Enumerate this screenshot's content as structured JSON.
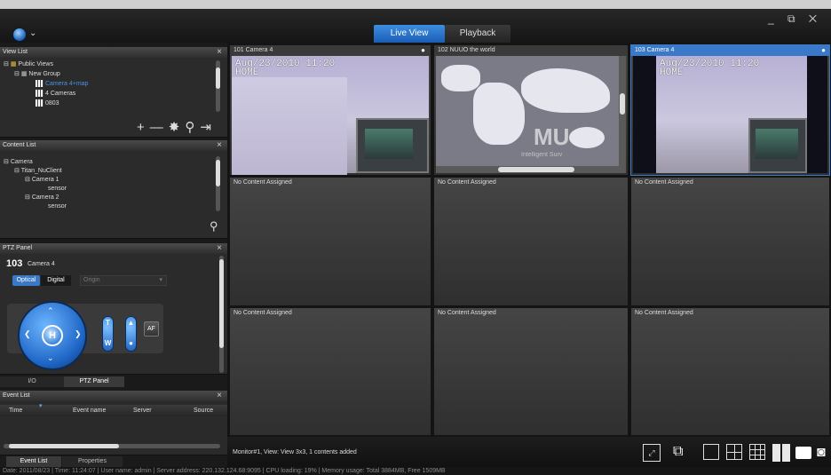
{
  "header": {
    "tabs": [
      {
        "label": "Live View",
        "active": true
      },
      {
        "label": "Playback",
        "active": false
      }
    ],
    "logo_caret": "⌄",
    "window_controls": "_ ⧉ ✕"
  },
  "view_list": {
    "title": "View List",
    "items": [
      {
        "label": "Public Views",
        "prefix": "⊟"
      },
      {
        "label": "New Group",
        "prefix": "⊟"
      },
      {
        "label": "Camera 4+map",
        "selected": true
      },
      {
        "label": "4 Cameras"
      },
      {
        "label": "0803"
      }
    ],
    "toolbar": [
      "+",
      "—",
      "✸",
      "⚲",
      "⇥"
    ]
  },
  "content_list": {
    "title": "Content List",
    "items": [
      {
        "label": "Camera",
        "prefix": "⊟"
      },
      {
        "label": "Titan_NuClient",
        "prefix": "⊟"
      },
      {
        "label": "Camera 1",
        "prefix": "⊟"
      },
      {
        "label": "sensor"
      },
      {
        "label": "Camera 2",
        "prefix": "⊟"
      },
      {
        "label": "sensor"
      }
    ]
  },
  "ptz_panel": {
    "title": "PTZ Panel",
    "camera_id": "103",
    "camera_name": "Camera 4",
    "modes": [
      "Optical",
      "Digital"
    ],
    "active_mode": "Optical",
    "origin_select": "Origin",
    "home_label": "H",
    "tele": "T",
    "wide": "W",
    "af": "AF",
    "bottom_tabs": [
      "I/O",
      "PTZ Panel"
    ]
  },
  "event_list": {
    "title": "Event List",
    "columns": [
      "Time",
      "Event name",
      "Server",
      "Source"
    ],
    "bottom_tabs": [
      "Event List",
      "Properties"
    ]
  },
  "grid": {
    "cells": [
      {
        "title": "101  Camera 4",
        "osd": "Aug/23/2010 11:20\nHOME",
        "type": "camera"
      },
      {
        "title": "102  NUUO the world",
        "type": "map"
      },
      {
        "title": "103  Camera 4",
        "osd": "Aug/23/2010 11:20\nHOME",
        "type": "camera",
        "selected": true
      },
      {
        "title": "No Content Assigned"
      },
      {
        "title": "No Content Assigned"
      },
      {
        "title": "No Content Assigned"
      },
      {
        "title": "No Content Assigned"
      },
      {
        "title": "No Content Assigned"
      },
      {
        "title": "No Content Assigned"
      }
    ],
    "map_text": [
      "MU",
      "Intelligent Surv"
    ]
  },
  "monitor_status": "Monitor#1, View: View 3x3, 1 contents added",
  "status_bar": "Date: 2011/08/23  |  Time: 11:24:07  |  User name: admin  |  Server address: 220.132.124.68:9095  |  CPU loading: 19%  |  Memory usage: Total 3884MB, Free 1509MB",
  "colors": {
    "accent": "#3a79c8",
    "panel": "#2b2b2b",
    "tree_selected": "#4a90e2"
  }
}
